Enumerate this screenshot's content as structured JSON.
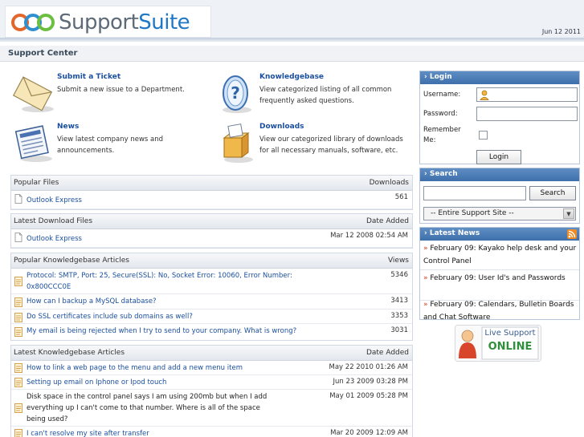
{
  "header": {
    "logo_part1": "Support",
    "logo_part2": "Suite",
    "date": "Jun 12 2011"
  },
  "section_title": "Support Center",
  "tiles": [
    {
      "title": "Submit a Ticket",
      "desc": "Submit a new issue to a Department."
    },
    {
      "title": "Knowledgebase",
      "desc": "View categorized listing of all common frequently asked questions."
    },
    {
      "title": "News",
      "desc": "View latest company news and announcements."
    },
    {
      "title": "Downloads",
      "desc": "View our categorized library of downloads for all necessary manuals, software, etc."
    }
  ],
  "popular_files": {
    "title": "Popular Files",
    "col": "Downloads",
    "rows": [
      {
        "name": "Outlook Express",
        "value": "561"
      }
    ]
  },
  "latest_downloads": {
    "title": "Latest Download Files",
    "col": "Date Added",
    "rows": [
      {
        "name": "Outlook Express",
        "value": "Mar 12 2008 02:54 AM"
      }
    ]
  },
  "popular_kb": {
    "title": "Popular Knowledgebase Articles",
    "col": "Views",
    "rows": [
      {
        "name": "Protocol: SMTP, Port: 25, Secure(SSL): No, Socket Error: 10060, Error Number: 0x800CCC0E",
        "value": "5346"
      },
      {
        "name": "How can I backup a MySQL database?",
        "value": "3413"
      },
      {
        "name": "Do SSL certificates include sub domains as well?",
        "value": "3353"
      },
      {
        "name": "My email is being rejected when I try to send to your company. What is wrong?",
        "value": "3031"
      }
    ]
  },
  "latest_kb": {
    "title": "Latest Knowledgebase Articles",
    "col": "Date Added",
    "rows": [
      {
        "name": "How to link a web page to the menu and add a new menu item",
        "value": "May 22 2010 01:26 AM"
      },
      {
        "name": "Setting up email on Iphone or Ipod touch",
        "value": "Jun 23 2009 03:28 PM"
      },
      {
        "name": "Disk space in the control panel says I am using 200mb but when I add everything up I can't come to that number. Where is all of the space being used?",
        "value": "May 01 2009 05:28 PM"
      },
      {
        "name": "I can't resolve my site after transfer",
        "value": "Mar 20 2009 12:09 AM"
      }
    ]
  },
  "login": {
    "title": "Login",
    "username_label": "Username:",
    "password_label": "Password:",
    "remember_label": "Remember Me:",
    "username_value": "",
    "password_value": "",
    "button": "Login"
  },
  "search": {
    "title": "Search",
    "value": "",
    "button": "Search",
    "scope": "-- Entire Support Site --"
  },
  "news": {
    "title": "Latest News",
    "items": [
      "February 09: Kayako help desk and your Control Panel",
      "February 09: User Id's and Passwords",
      "February 09: Calendars, Bulletin Boards and Chat Software"
    ]
  },
  "live_support": {
    "line1": "Live Support",
    "line2": "ONLINE"
  },
  "colors": {
    "accent": "#3f6fab",
    "link": "#1a4e9e",
    "online": "#2f8f3a"
  }
}
